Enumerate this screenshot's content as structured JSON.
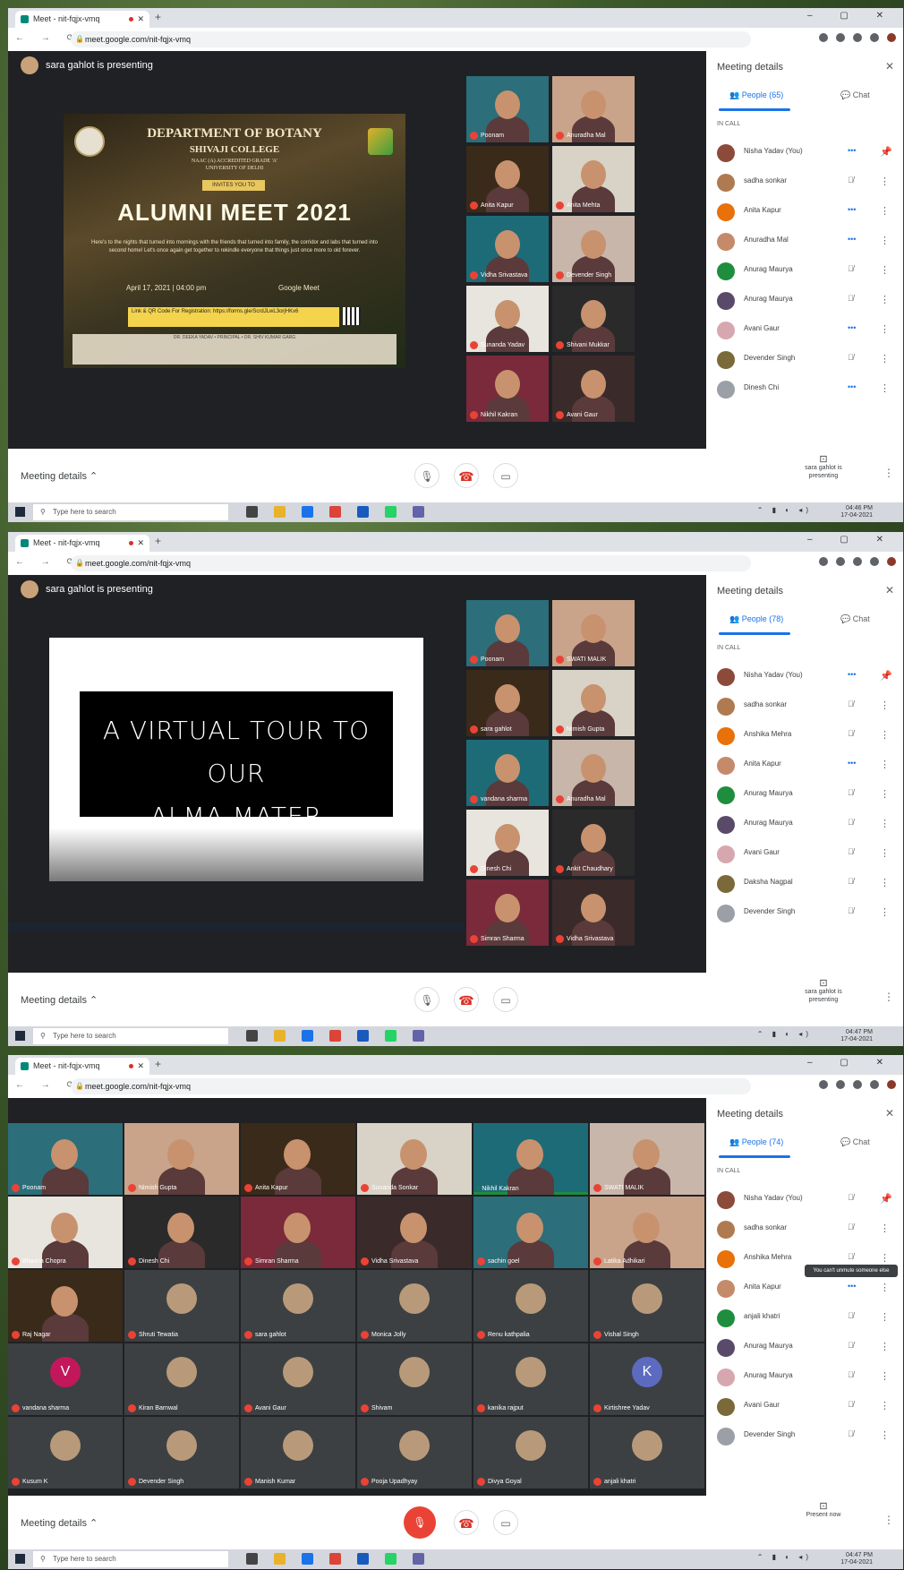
{
  "browser": {
    "tab_title": "Meet - nit-fqjx-vmq",
    "url": "meet.google.com/nit-fqjx-vmq",
    "new_tab": "+",
    "window_controls": "– ▢ ✕"
  },
  "meet": {
    "presenting_text": "sara gahlot is presenting",
    "panel_title": "Meeting details",
    "tab_chat": "Chat",
    "in_call_label": "IN CALL",
    "meeting_details": "Meeting details",
    "presenting_btn": "sara gahlot is presenting",
    "present_now": "Present now",
    "tooltip": "You can't unmute someone else"
  },
  "taskbar": {
    "search_placeholder": "Type here to search",
    "tray_icons": "⌃ ▮ ◐ ◂)",
    "time1": "04:46 PM",
    "time2": "04:47 PM",
    "time3": "04:47 PM",
    "date": "17-04-2021",
    "lang": "ENG"
  },
  "screenshot1": {
    "people_tab": "People (65)",
    "slide": {
      "dept": "DEPARTMENT OF BOTANY",
      "college": "SHIVAJI COLLEGE",
      "naac": "NAAC (A) ACCREDITED GRADE 'A'",
      "uni": "UNIVERSITY OF DELHI",
      "tag": "INVITES YOU TO",
      "title": "ALUMNI MEET 2021",
      "blurb": "Here's to the nights that turned into mornings with the friends that turned into family, the corridor and labs that turned into second home! Let's once again get together to rekindle everyone that things just once more to old forever.",
      "date": "April 17, 2021 | 04:00 pm",
      "platform": "Google Meet",
      "register": "Link & QR Code For Registration: https://forms.gle/ScrdJLwL3orjHKx6",
      "footer": "DR. DEEKA YADAV • PRINCIPAL • DR. SHIV KUMAR GARG"
    },
    "tiles": [
      "Poonam",
      "Anuradha Mal",
      "Anita Kapur",
      "Anita Mehta",
      "Vidha Srivastava",
      "Devender Singh",
      "Sunanda Yadav",
      "Shivani Mukkar",
      "Nikhil Kakran",
      "Avani Gaur"
    ],
    "people": [
      "Nisha Yadav (You)",
      "sadha sonkar",
      "Anita Kapur",
      "Anuradha Mal",
      "Anurag Maurya",
      "Anurag Maurya",
      "Avani Gaur",
      "Devender Singh",
      "Dinesh Chi"
    ]
  },
  "screenshot2": {
    "people_tab": "People (78)",
    "slide": {
      "line1": "A VIRTUAL TOUR TO OUR",
      "line2": "ALMA MATER"
    },
    "tiles": [
      "Poonam",
      "SWATI MALIK",
      "sara gahlot",
      "Nimish Gupta",
      "vandana sharma",
      "Anuradha Mal",
      "Dinesh Chi",
      "Ankit Chaudhary",
      "Simran Sharma",
      "Vidha Srivastava"
    ],
    "people": [
      "Nisha Yadav (You)",
      "sadha sonkar",
      "Anshika Mehra",
      "Anita Kapur",
      "Anurag Maurya",
      "Anurag Maurya",
      "Avani Gaur",
      "Daksha Nagpal",
      "Devender Singh"
    ]
  },
  "screenshot3": {
    "people_tab": "People (74)",
    "tiles_row1": [
      "Poonam",
      "Nimish Gupta",
      "Anita Kapur",
      "Sunanda Sonkar",
      "Nikhil Kakran",
      "SWATI MALIK"
    ],
    "tiles_row2": [
      "Bhavna Chopra",
      "Dinesh Chi",
      "Simran Sharma",
      "Vidha Srivastava",
      "sachin goel",
      "Latika Adhikari"
    ],
    "tiles_row3": [
      "Raj Nagar",
      "Shruti Tewatia",
      "sara gahlot",
      "Monica Jolly",
      "Renu kathpalia",
      "Vishal Singh"
    ],
    "tiles_row4": [
      "vandana sharma",
      "Kiran Barnwal",
      "Avani Gaur",
      "Shivam",
      "kanika rajput",
      "Kirtishree Yadav"
    ],
    "tiles_row5": [
      "Kusum K",
      "Devender Singh",
      "Manish Kumar",
      "Pooja Upadhyay",
      "Divya Goyal",
      "anjali khatri"
    ],
    "people": [
      "Nisha Yadav (You)",
      "sadha sonkar",
      "Anshika Mehra",
      "Anita Kapur",
      "anjali khatri",
      "Anurag Maurya",
      "Anurag Maurya",
      "Avani Gaur",
      "Devender Singh"
    ]
  },
  "colors": {
    "meet_bg": "#202124",
    "mute_red": "#ea4335",
    "speaking_green": "#1e8e3e",
    "accent_blue": "#1a73e8"
  }
}
